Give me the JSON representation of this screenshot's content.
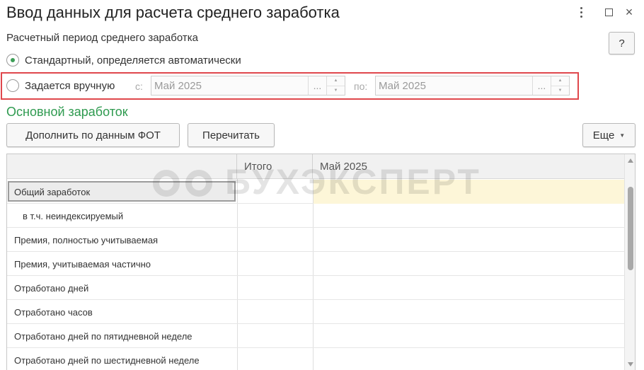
{
  "window": {
    "title": "Ввод данных для расчета среднего заработка",
    "close_glyph": "×"
  },
  "period": {
    "label": "Расчетный период среднего заработка",
    "help_label": "?",
    "options": [
      {
        "label": "Стандартный, определяется автоматически",
        "selected": true
      },
      {
        "label": "Задается вручную",
        "selected": false
      }
    ],
    "from_label": "с:",
    "from_value": "Май 2025",
    "to_label": "по:",
    "to_value": "Май 2025",
    "select_glyph": "...",
    "spin_up": "▲",
    "spin_down": "▼"
  },
  "section": {
    "title": "Основной заработок"
  },
  "toolbar": {
    "fill_fot_label": "Дополнить по данным ФОТ",
    "reread_label": "Перечитать",
    "more_label": "Еще",
    "more_caret": "▼"
  },
  "table": {
    "columns": [
      "",
      "Итого",
      "Май 2025"
    ],
    "rows": [
      {
        "name": "Общий заработок",
        "indent": false
      },
      {
        "name": "в т.ч. неиндексируемый",
        "indent": true
      },
      {
        "name": "Премия, полностью учитываемая",
        "indent": false
      },
      {
        "name": "Премия, учитываемая частично",
        "indent": false
      },
      {
        "name": "Отработано дней",
        "indent": false
      },
      {
        "name": "Отработано часов",
        "indent": false
      },
      {
        "name": "Отработано дней по пятидневной неделе",
        "indent": false
      },
      {
        "name": "Отработано дней по шестидневной неделе",
        "indent": false
      }
    ]
  },
  "watermark": {
    "text": "БУХЭКСПЕРТ"
  },
  "colors": {
    "accent_green": "#2e9a4f",
    "highlight_red": "#e0474c",
    "current_cell_bg": "#fdf6d8"
  }
}
